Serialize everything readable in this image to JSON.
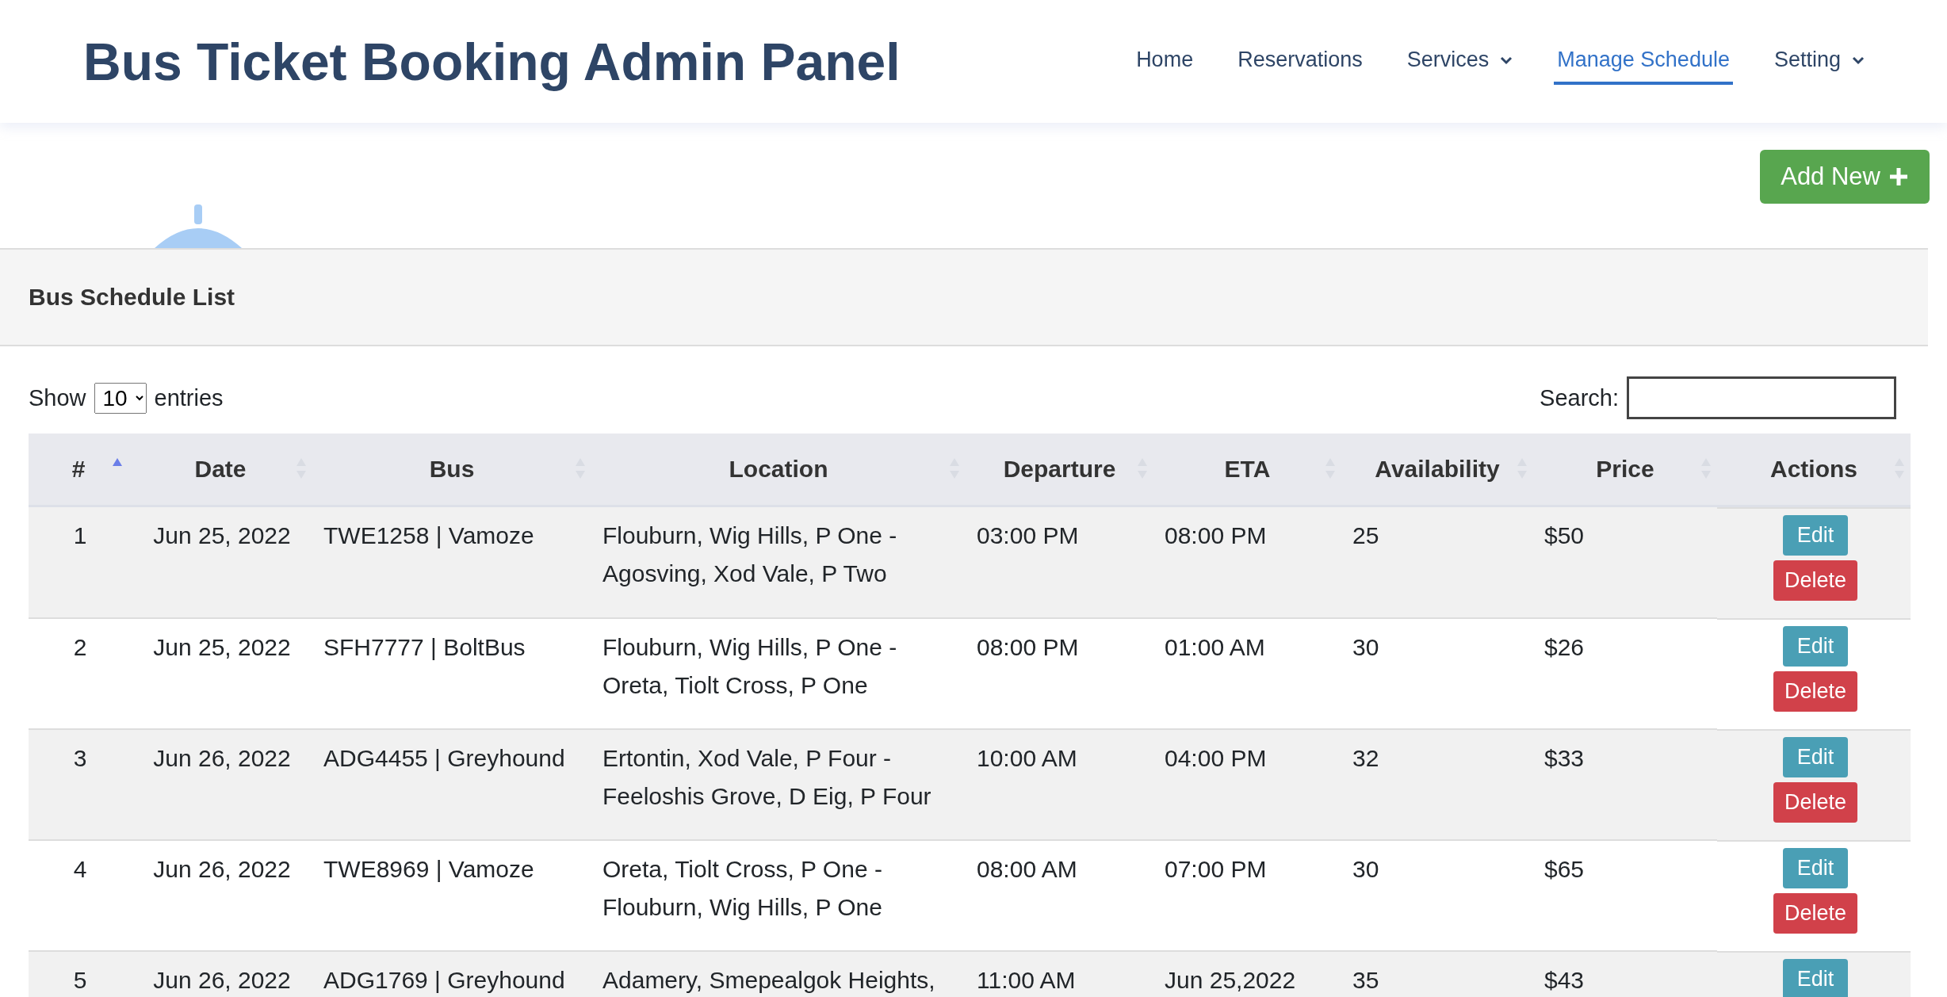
{
  "header": {
    "title": "Bus Ticket Booking Admin Panel"
  },
  "nav": [
    {
      "label": "Home",
      "selected": false,
      "dropdown": false
    },
    {
      "label": "Reservations",
      "selected": false,
      "dropdown": false
    },
    {
      "label": "Services",
      "selected": false,
      "dropdown": true
    },
    {
      "label": "Manage Schedule",
      "selected": true,
      "dropdown": false
    },
    {
      "label": "Setting",
      "selected": false,
      "dropdown": true
    }
  ],
  "add_button": "Add New",
  "panel": {
    "title": "Bus Schedule List"
  },
  "length_control": {
    "before": "Show",
    "value": "10",
    "after": "entries"
  },
  "search": {
    "label": "Search:"
  },
  "table": {
    "columns": [
      {
        "label": "#",
        "sorted": true
      },
      {
        "label": "Date",
        "sorted": false
      },
      {
        "label": "Bus",
        "sorted": false
      },
      {
        "label": "Location",
        "sorted": false
      },
      {
        "label": "Departure",
        "sorted": false
      },
      {
        "label": "ETA",
        "sorted": false
      },
      {
        "label": "Availability",
        "sorted": false
      },
      {
        "label": "Price",
        "sorted": false
      },
      {
        "label": "Actions",
        "sorted": false
      }
    ],
    "rows": [
      {
        "cells": [
          "1",
          "Jun 25, 2022",
          "TWE1258 | Vamoze",
          "Flouburn, Wig Hills, P One - Agosving, Xod Vale, P Two",
          "03:00 PM",
          "08:00 PM",
          "25",
          "$50"
        ],
        "actions": [
          {
            "label": "Edit",
            "kind": "edit"
          },
          {
            "label": "Delete",
            "kind": "delete"
          }
        ]
      },
      {
        "cells": [
          "2",
          "Jun 25, 2022",
          "SFH7777 | BoltBus",
          "Flouburn, Wig Hills, P One - Oreta, Tiolt Cross, P One",
          "08:00 PM",
          "01:00 AM",
          "30",
          "$26"
        ],
        "actions": [
          {
            "label": "Edit",
            "kind": "edit"
          },
          {
            "label": "Delete",
            "kind": "delete"
          }
        ]
      },
      {
        "cells": [
          "3",
          "Jun 26, 2022",
          "ADG4455 | Greyhound",
          "Ertontin, Xod Vale, P Four - Feeloshis Grove, D Eig, P Four",
          "10:00 AM",
          "04:00 PM",
          "32",
          "$33"
        ],
        "actions": [
          {
            "label": "Edit",
            "kind": "edit"
          },
          {
            "label": "Delete",
            "kind": "delete"
          }
        ]
      },
      {
        "cells": [
          "4",
          "Jun 26, 2022",
          "TWE8969 | Vamoze",
          "Oreta, Tiolt Cross, P One - Flouburn, Wig Hills, P One",
          "08:00 AM",
          "07:00 PM",
          "30",
          "$65"
        ],
        "actions": [
          {
            "label": "Edit",
            "kind": "edit"
          },
          {
            "label": "Delete",
            "kind": "delete"
          }
        ]
      },
      {
        "cells": [
          "5",
          "Jun 26, 2022",
          "ADG1769 | Greyhound",
          "Adamery, Smepealgok Heights,",
          "11:00 AM",
          "Jun 25,2022",
          "35",
          "$43"
        ],
        "actions": [
          {
            "label": "Edit",
            "kind": "edit"
          }
        ]
      }
    ]
  }
}
